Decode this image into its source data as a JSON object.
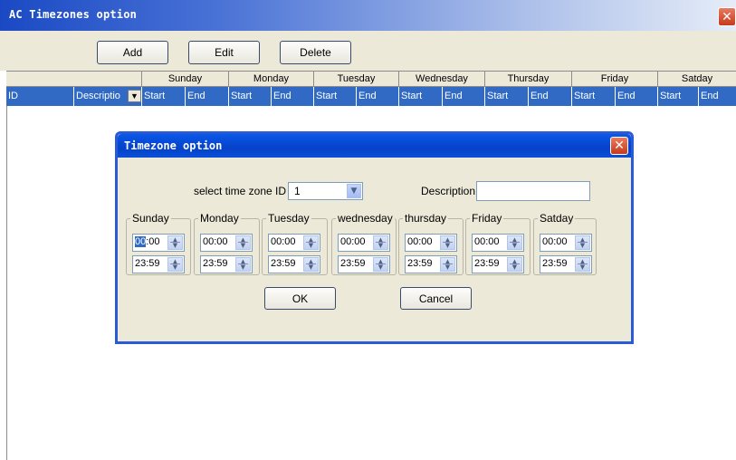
{
  "window": {
    "title": "AC Timezones option"
  },
  "toolbar": {
    "add_label": "Add",
    "edit_label": "Edit",
    "delete_label": "Delete"
  },
  "grid": {
    "day_headers": [
      "Sunday",
      "Monday",
      "Tuesday",
      "Wednesday",
      "Thursday",
      "Friday",
      "Satday"
    ],
    "id_header": "ID",
    "description_header": "Descriptio",
    "start_label": "Start",
    "end_label": "End"
  },
  "dialog": {
    "title": "Timezone option",
    "select_label": "select time zone ID",
    "selected_id": "1",
    "description_label": "Description",
    "description_value": "",
    "days": [
      {
        "name": "Sunday",
        "start": "00:00",
        "end": "23:59"
      },
      {
        "name": "Monday",
        "start": "00:00",
        "end": "23:59"
      },
      {
        "name": "Tuesday",
        "start": "00:00",
        "end": "23:59"
      },
      {
        "name": "wednesday",
        "start": "00:00",
        "end": "23:59"
      },
      {
        "name": "thursday",
        "start": "00:00",
        "end": "23:59"
      },
      {
        "name": "Friday",
        "start": "00:00",
        "end": "23:59"
      },
      {
        "name": "Satday",
        "start": "00:00",
        "end": "23:59"
      }
    ],
    "ok_label": "OK",
    "cancel_label": "Cancel"
  },
  "colors": {
    "titlebar": "#1a49c4",
    "grid_header_selected": "#316ac5",
    "dialog_bg": "#ece9d8"
  }
}
